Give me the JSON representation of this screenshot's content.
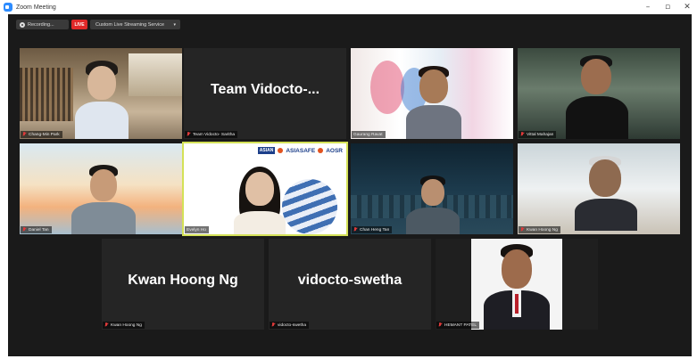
{
  "window": {
    "title": "Zoom Meeting",
    "controls": {
      "minimize": "–",
      "maximize": "▫",
      "close": "✕"
    }
  },
  "toolbar": {
    "recording_label": "Recording...",
    "live_label": "LIVE",
    "stream_label": "Custom Live Streaming Service",
    "stream_caret": "▾"
  },
  "participants": [
    {
      "name": "Chang-Min Park",
      "video": true
    },
    {
      "name": "Team Vidocto- Saritha",
      "video": false,
      "display_name": "Team  Vidocto-..."
    },
    {
      "name": "Gaurang Ravat",
      "video": true
    },
    {
      "name": "Vittal Mahajan",
      "video": true
    },
    {
      "name": "Daniel Tan",
      "video": true
    },
    {
      "name": "Evelyn Ho",
      "video": true,
      "active_speaker": true
    },
    {
      "name": "Chan Heng Tan",
      "video": true
    },
    {
      "name": "Kwan Hoong Ng",
      "video": true
    },
    {
      "name": "Kwan Hoong Ng",
      "video": false,
      "display_name": "Kwan Hoong Ng"
    },
    {
      "name": "vidocto-swetha",
      "video": false,
      "display_name": "vidocto-swetha"
    },
    {
      "name": "HEMANT PATEL",
      "video": true
    }
  ],
  "logos": {
    "box": "ASIAN",
    "asiasafe": "ASIASAFE",
    "aosr": "AOSR"
  },
  "colors": {
    "meeting_bg": "#1a1a1a",
    "tile_bg": "#252525",
    "live_red": "#e02828",
    "active_speaker_border": "#d4e157",
    "zoom_blue": "#2d8cff",
    "mute_red": "#e03a3a"
  }
}
